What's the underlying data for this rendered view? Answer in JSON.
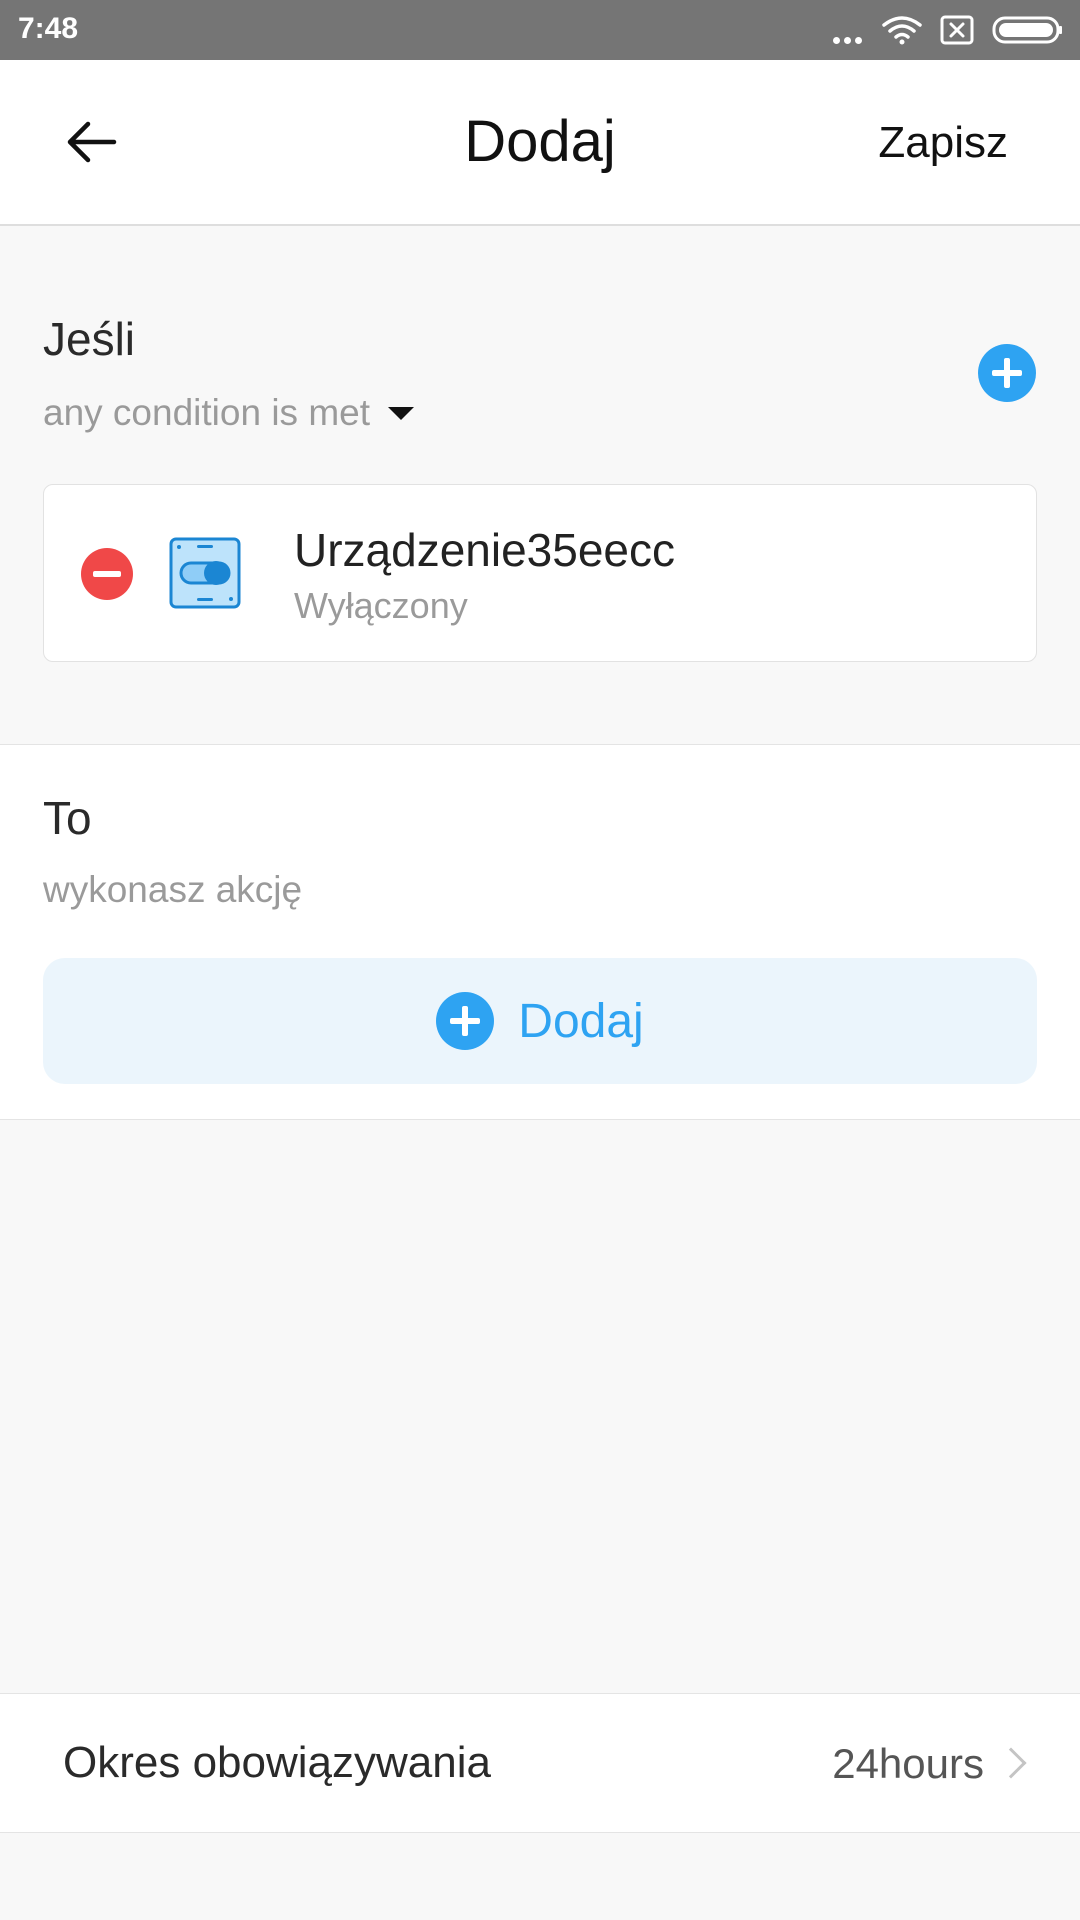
{
  "status_bar": {
    "time": "7:48",
    "icons": [
      "more-dots-icon",
      "wifi-icon",
      "sim-missing-icon",
      "battery-icon"
    ]
  },
  "header": {
    "title": "Dodaj",
    "save_label": "Zapisz",
    "back_icon": "arrow-left-icon"
  },
  "if_section": {
    "title": "Jeśli",
    "mode": "any condition is met",
    "conditions": [
      {
        "device_name": "Urządzenie35eecc",
        "state": "Wyłączony",
        "icon": "switch-device-icon"
      }
    ]
  },
  "then_section": {
    "title": "To",
    "subtitle": "wykonasz akcję",
    "add_label": "Dodaj"
  },
  "validity": {
    "label": "Okres obowiązywania",
    "value": "24hours"
  },
  "colors": {
    "accent": "#2ea3f2",
    "danger": "#f04848",
    "statusbar": "#757575"
  }
}
